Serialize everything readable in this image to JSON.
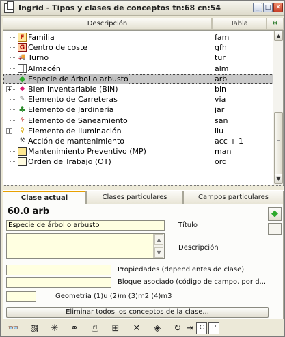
{
  "window": {
    "title": "Ingrid - Tipos y clases de conceptos tn:68 cn:54"
  },
  "columns": {
    "description": "Descripción",
    "table": "Tabla",
    "icon_glyph": "✻"
  },
  "tree": {
    "rows": [
      {
        "label": "Familia",
        "code": "fam",
        "icon": "familia-box-icon",
        "glyph": "F",
        "selected": false,
        "expandable": false
      },
      {
        "label": "Centro de coste",
        "code": "gfh",
        "icon": "cost-center-box-icon",
        "glyph": "G",
        "selected": false,
        "expandable": false
      },
      {
        "label": "Turno",
        "code": "tur",
        "icon": "truck-icon",
        "glyph": "🚚",
        "selected": false,
        "expandable": false
      },
      {
        "label": "Almacén",
        "code": "alm",
        "icon": "warehouse-grid-icon",
        "glyph": "",
        "selected": false,
        "expandable": false
      },
      {
        "label": "Especie de árbol o arbusto",
        "code": "arb",
        "icon": "leaf-icon",
        "glyph": "◆",
        "selected": true,
        "expandable": false
      },
      {
        "label": "Bien Inventariable (BIN)",
        "code": "bin",
        "icon": "gem-icon",
        "glyph": "◆",
        "selected": false,
        "expandable": true
      },
      {
        "label": "Elemento de Carreteras",
        "code": "via",
        "icon": "pencil-icon",
        "glyph": "✎",
        "selected": false,
        "expandable": false
      },
      {
        "label": "Elemento de Jardinería",
        "code": "jar",
        "icon": "tree-icon",
        "glyph": "♣",
        "selected": false,
        "expandable": false
      },
      {
        "label": "Elemento de Saneamiento",
        "code": "san",
        "icon": "pipe-icon",
        "glyph": "⚘",
        "selected": false,
        "expandable": false
      },
      {
        "label": "Elemento de Iluminación",
        "code": "ilu",
        "icon": "bulb-icon",
        "glyph": "♀",
        "selected": false,
        "expandable": true
      },
      {
        "label": "Acción de mantenimiento",
        "code": "acc + 1",
        "icon": "wrench-icon",
        "glyph": "⚒",
        "selected": false,
        "expandable": false
      },
      {
        "label": "Mantenimiento Preventivo (MP)",
        "code": "man",
        "icon": "screen-icon",
        "glyph": "",
        "selected": false,
        "expandable": false
      },
      {
        "label": "Orden de Trabajo (OT)",
        "code": "ord",
        "icon": "document-icon",
        "glyph": "",
        "selected": false,
        "expandable": false
      }
    ]
  },
  "tabs": [
    {
      "label": "Clase actual",
      "active": true
    },
    {
      "label": "Clases particulares",
      "active": false
    },
    {
      "label": "Campos particulares",
      "active": false
    }
  ],
  "detail": {
    "current_class": "60.0 arb",
    "title_value": "Especie de árbol o arbusto",
    "title_label": "Título",
    "description_value": "",
    "description_label": "Descripción",
    "properties_value": "",
    "properties_label": "Propiedades (dependientes de clase)",
    "block_value": "",
    "block_label": "Bloque asociado (código de campo, por d...",
    "geometry_value": "",
    "geometry_label": "Geometría (1)u (2)m (3)m2 (4)m3",
    "delete_button": "Eliminar todos los conceptos de la clase..."
  },
  "toolbar": {
    "buttons": [
      {
        "name": "binoculars-icon",
        "glyph": "👓"
      },
      {
        "name": "map-icon",
        "glyph": "▧"
      },
      {
        "name": "sparkle-icon",
        "glyph": "✳"
      },
      {
        "name": "link-icon",
        "glyph": "⚭"
      },
      {
        "name": "printer-icon",
        "glyph": "⎙"
      },
      {
        "name": "hierarchy-icon",
        "glyph": "⊞"
      },
      {
        "name": "delete-icon",
        "glyph": "✕"
      },
      {
        "name": "eraser-icon",
        "glyph": "◈"
      },
      {
        "name": "refresh-icon",
        "glyph": "↻"
      },
      {
        "name": "exit-icon",
        "glyph": "⇥"
      },
      {
        "name": "comment-icon",
        "glyph": "C"
      },
      {
        "name": "print-preview-icon",
        "glyph": "P"
      }
    ]
  }
}
